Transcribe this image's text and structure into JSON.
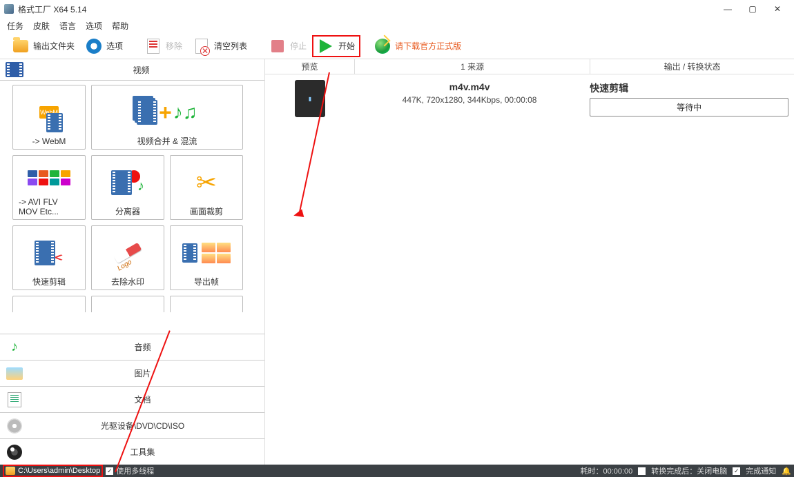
{
  "titlebar": {
    "title": "格式工厂 X64 5.14"
  },
  "menu": {
    "tasks": "任务",
    "skin": "皮肤",
    "language": "语言",
    "options": "选项",
    "help": "帮助"
  },
  "toolbar": {
    "output_folder": "输出文件夹",
    "options": "选项",
    "remove": "移除",
    "clear_list": "清空列表",
    "stop": "停止",
    "start": "开始",
    "download_official": "请下载官方正式版"
  },
  "categories": {
    "video": "视频",
    "audio": "音频",
    "image": "图片",
    "document": "文档",
    "disc": "光驱设备\\DVD\\CD\\ISO",
    "tools": "工具集"
  },
  "tiles": {
    "to_webm": "-> WebM",
    "merge_mux": "视频合并 & 混流",
    "to_avi_etc_line1": "-> AVI FLV",
    "to_avi_etc_line2": "MOV Etc...",
    "separator": "分离器",
    "crop": "画面裁剪",
    "quick_cut": "快速剪辑",
    "remove_watermark": "去除水印",
    "export_frames": "导出帧"
  },
  "columns": {
    "preview": "预览",
    "source": "1 来源",
    "output": "输出 / 转换状态"
  },
  "task": {
    "filename": "m4v.m4v",
    "meta": "447K, 720x1280, 344Kbps, 00:00:08",
    "operation": "快速剪辑",
    "status": "等待中"
  },
  "statusbar": {
    "path": "C:\\Users\\admin\\Desktop",
    "multithread": "使用多线程",
    "elapsed_label": "耗时：",
    "elapsed_value": "00:00:00",
    "after_convert": "转换完成后：关闭电脑",
    "completion_notify": "完成通知"
  }
}
